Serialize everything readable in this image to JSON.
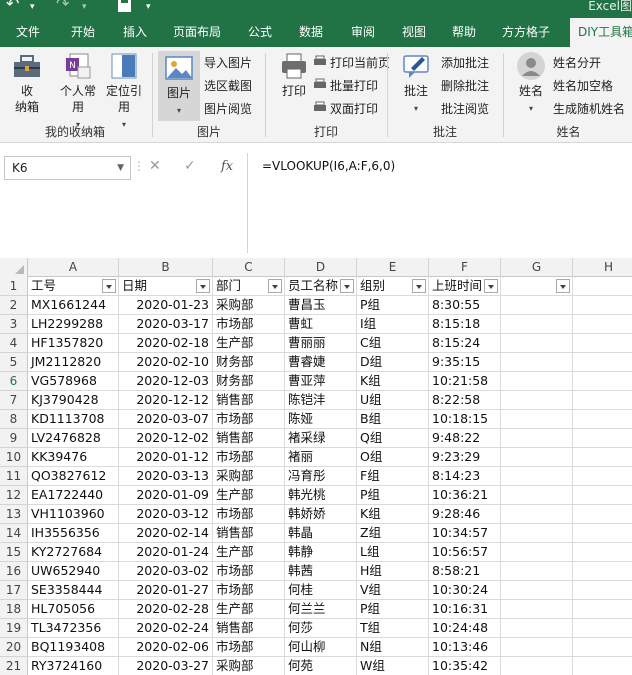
{
  "window": {
    "title": "Excel图"
  },
  "quick_access": {
    "undo_icon": "undo-icon",
    "redo_icon": "redo-icon",
    "save_icon": "save-icon"
  },
  "tabs": [
    "文件",
    "开始",
    "插入",
    "页面布局",
    "公式",
    "数据",
    "审阅",
    "视图",
    "帮助",
    "方方格子",
    "DIY工具箱"
  ],
  "active_tab": "DIY工具箱",
  "ribbon": {
    "group_collect": {
      "label": "我的收纳箱",
      "collect_btn": "收\n纳箱",
      "personal_btn": "个人常\n用",
      "locate_btn": "定位引\n用"
    },
    "group_picture": {
      "label": "图片",
      "picture_btn": "图片",
      "import": "导入图片",
      "screenshot": "选区截图",
      "preview": "图片阅览"
    },
    "group_print": {
      "label": "打印",
      "print_btn": "打印",
      "print_current": "打印当前页",
      "batch_print": "批量打印",
      "duplex_print": "双面打印"
    },
    "group_comment": {
      "label": "批注",
      "comment_btn": "批注",
      "add": "添加批注",
      "delete": "删除批注",
      "preview": "批注阅览"
    },
    "group_name": {
      "label": "姓名",
      "name_btn": "姓名",
      "split": "姓名分开",
      "add_space": "姓名加空格",
      "random": "生成随机姓名"
    }
  },
  "formula_bar": {
    "name_box": "K6",
    "formula": "=VLOOKUP(I6,A:F,6,0)"
  },
  "columns": [
    "A",
    "B",
    "C",
    "D",
    "E",
    "F",
    "G",
    "H"
  ],
  "headers": [
    "工号",
    "日期",
    "部门",
    "员工名称",
    "组别",
    "上班时间"
  ],
  "rows": [
    [
      "MX1661244",
      "2020-01-23",
      "采购部",
      "曹昌玉",
      "P组",
      "8:30:55"
    ],
    [
      "LH2299288",
      "2020-03-17",
      "市场部",
      "曹虹",
      "I组",
      "8:15:18"
    ],
    [
      "HF1357820",
      "2020-02-18",
      "生产部",
      "曹丽丽",
      "C组",
      "8:15:24"
    ],
    [
      "JM2112820",
      "2020-02-10",
      "财务部",
      "曹睿婕",
      "D组",
      "9:35:15"
    ],
    [
      "VG578968",
      "2020-12-03",
      "财务部",
      "曹亚萍",
      "K组",
      "10:21:58"
    ],
    [
      "KJ3790428",
      "2020-12-12",
      "销售部",
      "陈铠沣",
      "U组",
      "8:22:58"
    ],
    [
      "KD1113708",
      "2020-03-07",
      "市场部",
      "陈娅",
      "B组",
      "10:18:15"
    ],
    [
      "LV2476828",
      "2020-12-02",
      "销售部",
      "褚采绿",
      "Q组",
      "9:48:22"
    ],
    [
      "KK39476",
      "2020-01-12",
      "市场部",
      "褚丽",
      "O组",
      "9:23:29"
    ],
    [
      "QO3827612",
      "2020-03-13",
      "采购部",
      "冯育彤",
      "F组",
      "8:14:23"
    ],
    [
      "EA1722440",
      "2020-01-09",
      "生产部",
      "韩光桃",
      "P组",
      "10:36:21"
    ],
    [
      "VH1103960",
      "2020-03-12",
      "市场部",
      "韩娇娇",
      "K组",
      "9:28:46"
    ],
    [
      "IH3556356",
      "2020-02-14",
      "销售部",
      "韩晶",
      "Z组",
      "10:34:57"
    ],
    [
      "KY2727684",
      "2020-01-24",
      "生产部",
      "韩静",
      "L组",
      "10:56:57"
    ],
    [
      "UW652940",
      "2020-03-02",
      "市场部",
      "韩茜",
      "H组",
      "8:58:21"
    ],
    [
      "SE3358444",
      "2020-01-27",
      "市场部",
      "何桂",
      "V组",
      "10:30:24"
    ],
    [
      "HL705056",
      "2020-02-28",
      "生产部",
      "何兰兰",
      "P组",
      "10:16:31"
    ],
    [
      "TL3472356",
      "2020-02-24",
      "销售部",
      "何莎",
      "T组",
      "10:24:48"
    ],
    [
      "BQ1193408",
      "2020-02-06",
      "市场部",
      "何山柳",
      "N组",
      "10:13:46"
    ],
    [
      "RY3724160",
      "2020-03-27",
      "采购部",
      "何苑",
      "W组",
      "10:35:42"
    ]
  ]
}
